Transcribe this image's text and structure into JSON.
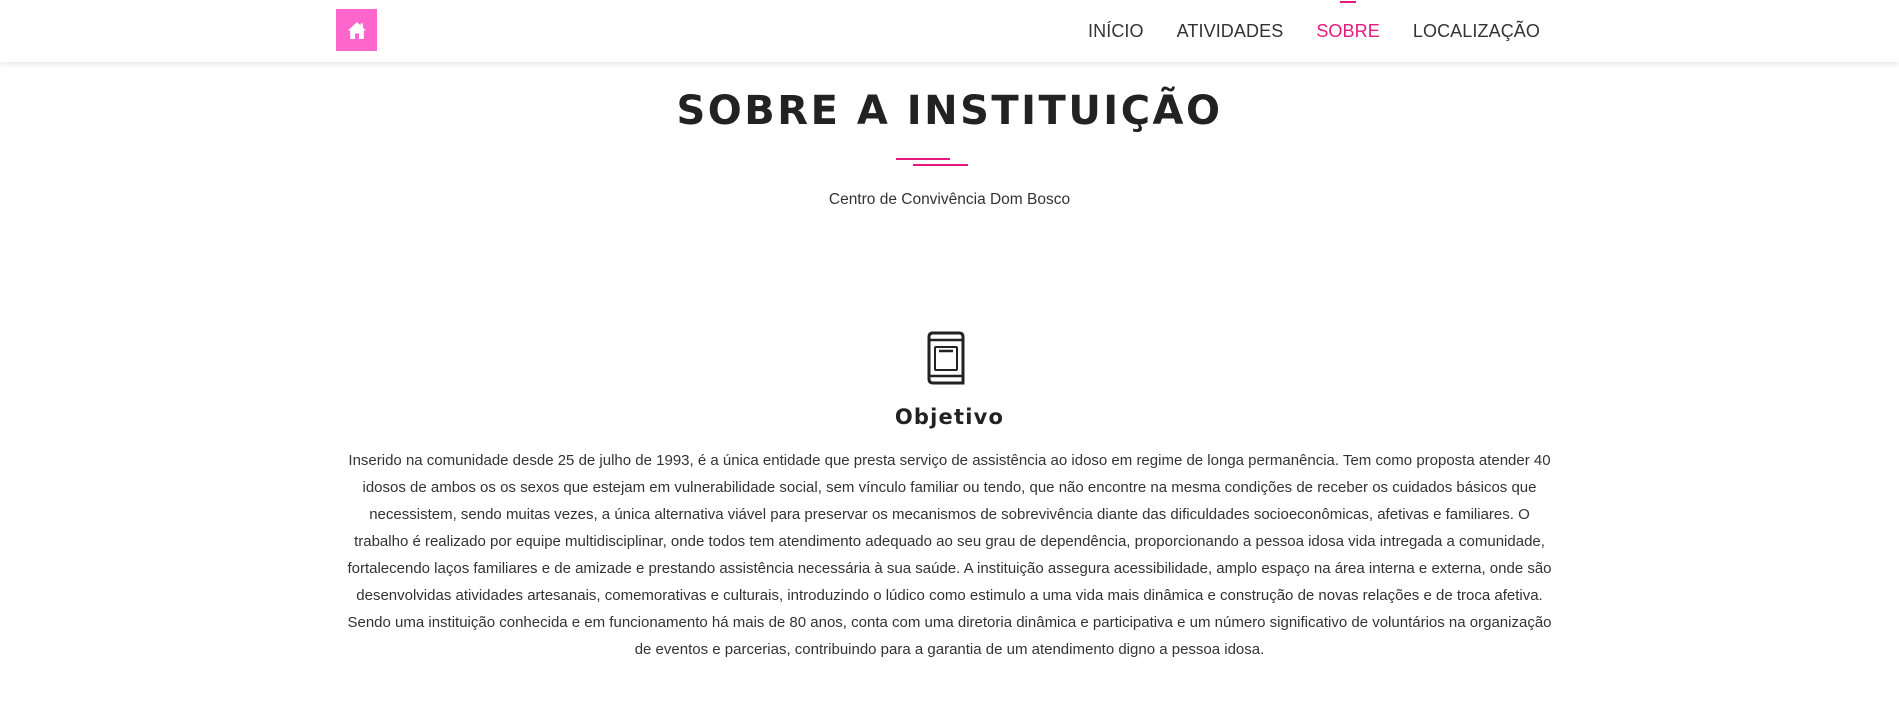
{
  "navbar": {
    "home_icon": "home-icon",
    "items": [
      {
        "label": "INÍCIO",
        "active": false
      },
      {
        "label": "ATIVIDADES",
        "active": false
      },
      {
        "label": "SOBRE",
        "active": true
      },
      {
        "label": "LOCALIZAÇÃO",
        "active": false
      }
    ]
  },
  "section": {
    "title": "SOBRE A INSTITUIÇÃO",
    "subtitle": "Centro de Convivência Dom Bosco"
  },
  "objective": {
    "icon": "book-icon",
    "title": "Objetivo",
    "text": "Inserido na comunidade desde 25 de julho de 1993, é a única entidade que presta serviço de assistência ao idoso em regime de longa permanência. Tem como proposta atender 40 idosos de ambos os os sexos que estejam em vulnerabilidade social, sem vínculo familiar ou tendo, que não encontre na mesma condições de receber os cuidados básicos que necessistem, sendo muitas vezes, a única alternativa viável para preservar os mecanismos de sobrevivência diante das dificuldades socioeconômicas, afetivas e familiares. O trabalho é realizado por equipe multidisciplinar, onde todos tem atendimento adequado ao seu grau de dependência, proporcionando a pessoa idosa vida intregada a comunidade, fortalecendo laços familiares e de amizade e prestando assistência necessária à sua saúde. A instituição assegura acessibilidade, amplo espaço na área interna e externa, onde são desenvolvidas atividades artesanais, comemorativas e culturais, introduzindo o lúdico como estimulo a uma vida mais dinâmica e construção de novas relações e de troca afetiva. Sendo uma instituição conhecida e em funcionamento há mais de 80 anos, conta com uma diretoria dinâmica e participativa e um número significativo de voluntários na organização de eventos e parcerias, contribuindo para a garantia de um atendimento digno a pessoa idosa."
  },
  "colors": {
    "accent": "#e6197f",
    "home_button": "#ff66cc",
    "text": "#333333"
  }
}
